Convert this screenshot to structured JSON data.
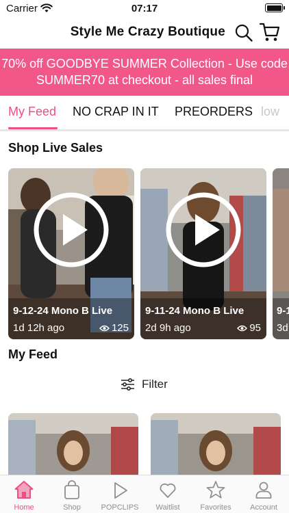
{
  "status": {
    "carrier": "Carrier",
    "time": "07:17"
  },
  "header": {
    "title": "Style Me Crazy Boutique"
  },
  "promo": {
    "line1": "70% off GOODBYE SUMMER Collection - Use code",
    "line2": "SUMMER70 at checkout - all sales final"
  },
  "tabs": [
    {
      "label": "My Feed"
    },
    {
      "label": "NO CRAP IN IT"
    },
    {
      "label": "PREORDERS"
    },
    {
      "label": "low"
    }
  ],
  "sections": {
    "live": "Shop Live Sales",
    "feed": "My Feed"
  },
  "live_cards": [
    {
      "title": "9-12-24 Mono B Live",
      "age": "1d 12h ago",
      "views": "125"
    },
    {
      "title": "9-11-24 Mono B Live",
      "age": "2d 9h ago",
      "views": "95"
    },
    {
      "title": "9-1",
      "age": "3d"
    }
  ],
  "filter": {
    "label": "Filter"
  },
  "tab_bar": [
    {
      "label": "Home",
      "icon": "home-icon"
    },
    {
      "label": "Shop",
      "icon": "bag-icon"
    },
    {
      "label": "POPCLIPS",
      "icon": "play-icon"
    },
    {
      "label": "Waitlist",
      "icon": "heart-icon"
    },
    {
      "label": "Favorites",
      "icon": "star-icon"
    },
    {
      "label": "Account",
      "icon": "person-icon"
    }
  ],
  "colors": {
    "accent": "#ee4d86",
    "banner": "#f2578a"
  }
}
